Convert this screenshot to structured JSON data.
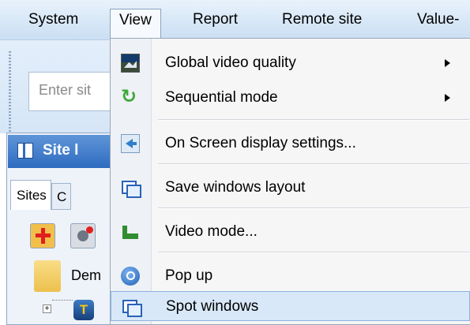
{
  "menubar": {
    "items": [
      "System",
      "View",
      "Report",
      "Remote site",
      "Value-"
    ]
  },
  "toolbar": {
    "site_search_placeholder": "Enter sit"
  },
  "panel": {
    "title": "Site l",
    "tabs": [
      "Sites",
      "C"
    ],
    "tree": {
      "folder_label": "Dem",
      "device_glyph": "T"
    }
  },
  "view_menu": {
    "items": [
      {
        "label": "Global video quality",
        "icon": "video-quality-icon",
        "submenu": true
      },
      {
        "label": "Sequential mode",
        "icon": "sequential-icon",
        "submenu": true
      },
      {
        "label": "On Screen display settings...",
        "icon": "osd-settings-icon",
        "submenu": false
      },
      {
        "label": "Save windows layout",
        "icon": "windows-layout-icon",
        "submenu": false
      },
      {
        "label": "Video mode...",
        "icon": "video-mode-icon",
        "submenu": false
      },
      {
        "label": "Pop up",
        "icon": "popup-icon",
        "submenu": false
      },
      {
        "label": "Spot windows",
        "icon": "spot-windows-icon",
        "submenu": false,
        "highlighted": true
      }
    ]
  },
  "colors": {
    "menubar_bg": "#d7e7f7",
    "highlight_bg": "#d8e8f8",
    "highlight_border": "#8db4df",
    "panel_title_bg": "#2f6cc0"
  }
}
